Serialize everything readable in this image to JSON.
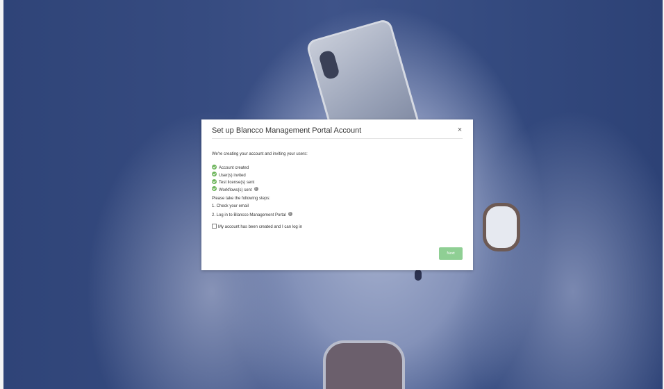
{
  "dialog": {
    "title": "Set up Blancco Management Portal Account",
    "close_glyph": "×",
    "intro": "We're creating your account and inviting your users:",
    "status_items": [
      {
        "label": "Account created",
        "icon": "check-circle-icon",
        "has_info": false
      },
      {
        "label": "User(s) invited",
        "icon": "check-circle-icon",
        "has_info": false
      },
      {
        "label": "Test license(s) sent",
        "icon": "check-circle-icon",
        "has_info": false
      },
      {
        "label": "Workflows(s) sent",
        "icon": "check-circle-icon",
        "has_info": true
      }
    ],
    "steps_intro": "Please take the following steps:",
    "steps": [
      "1. Check your email",
      "2. Log in to Blancco Management Portal"
    ],
    "info_glyph": "i",
    "confirm_label": "My account has been created and I can log in",
    "confirm_checked": false,
    "next_label": "Next"
  },
  "colors": {
    "overlay": "#3a4f82",
    "success": "#6cb45a",
    "next_button": "#8fcf94"
  }
}
